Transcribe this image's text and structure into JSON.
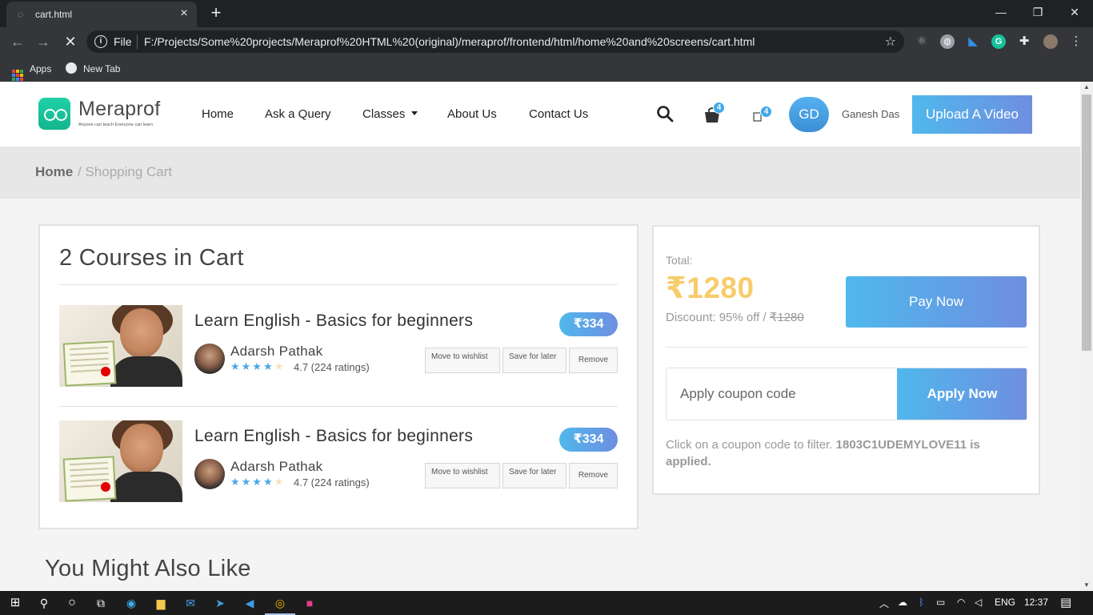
{
  "browser": {
    "tab_title": "cart.html",
    "file_label": "File",
    "url": "F:/Projects/Some%20projects/Meraprof%20HTML%20(original)/meraprof/frontend/html/home%20and%20screens/cart.html",
    "bookmarks": [
      {
        "label": "Apps"
      },
      {
        "label": "New Tab"
      }
    ]
  },
  "header": {
    "logo_name": "Meraprof",
    "logo_tagline": "Anyone can teach Everyone can learn",
    "nav": [
      {
        "label": "Home"
      },
      {
        "label": "Ask a Query"
      },
      {
        "label": "Classes"
      },
      {
        "label": "About Us"
      },
      {
        "label": "Contact Us"
      }
    ],
    "cart_count": "4",
    "notif_count": "4",
    "avatar_initials": "GD",
    "user_name": "Ganesh Das",
    "upload_label": "Upload A Video"
  },
  "breadcrumb": {
    "home": "Home",
    "current": "/ Shopping Cart"
  },
  "cart": {
    "heading": "2 Courses in Cart",
    "items": [
      {
        "title": "Learn English - Basics for beginners",
        "price": "₹334",
        "instructor": "Adarsh Pathak",
        "rating_text": "4.7 (224 ratings)",
        "stars_filled": 4,
        "stars_total": 5,
        "wishlist_label": "Move to wishlist",
        "save_label": "Save for later",
        "remove_label": "Remove"
      },
      {
        "title": "Learn English - Basics for beginners",
        "price": "₹334",
        "instructor": "Adarsh Pathak",
        "rating_text": "4.7 (224 ratings)",
        "stars_filled": 4,
        "stars_total": 5,
        "wishlist_label": "Move to wishlist",
        "save_label": "Save for later",
        "remove_label": "Remove"
      }
    ]
  },
  "summary": {
    "total_label": "Total:",
    "total_amount": "₹1280",
    "discount_label": "Discount: 95% off /",
    "original_price": "₹1280",
    "pay_label": "Pay Now",
    "coupon_placeholder": "Apply coupon code",
    "apply_label": "Apply Now",
    "hint_text": "Click on a coupon code to filter.",
    "hint_code": "1803C1UDEMYLOVE11 is applied."
  },
  "also": {
    "heading": "You Might Also Like"
  },
  "taskbar": {
    "lang": "ENG",
    "time": "12:37"
  },
  "colors": {
    "accent_gradient_start": "#4fb8ec",
    "accent_gradient_end": "#6f8ee0",
    "total_amount": "#f7cc6a",
    "logo_green": "#1fd1a7"
  }
}
